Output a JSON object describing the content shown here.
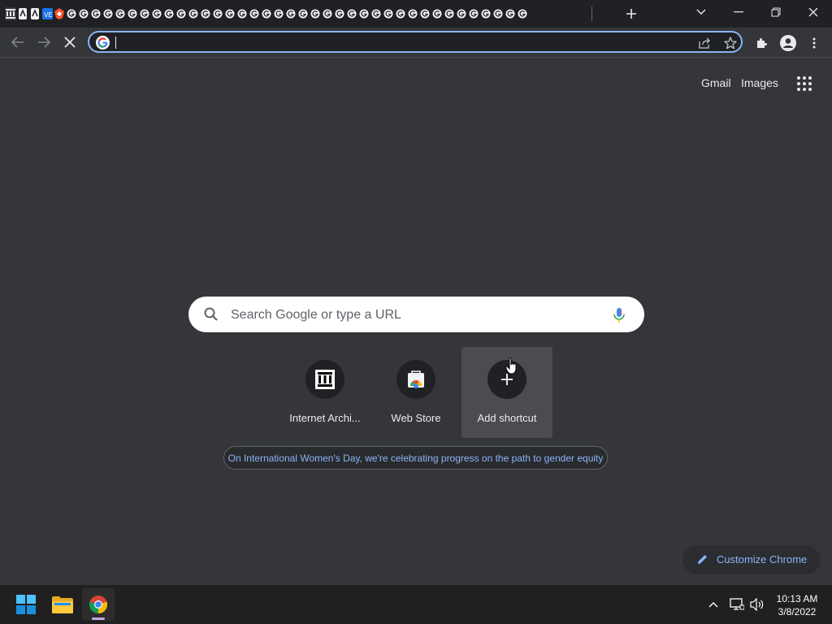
{
  "browser": {
    "omnibox": {
      "value": "",
      "placeholder": ""
    },
    "tab_favicons": [
      "internet-archive",
      "wayback",
      "wayback",
      "vlc",
      "brave",
      "google",
      "google",
      "google",
      "google",
      "google",
      "google",
      "google",
      "google",
      "google",
      "google",
      "google",
      "google",
      "google",
      "google",
      "google",
      "google",
      "google",
      "google",
      "google",
      "google",
      "google",
      "google",
      "google",
      "google",
      "google",
      "google",
      "google",
      "google",
      "google",
      "google",
      "google",
      "google",
      "google",
      "google",
      "google",
      "google",
      "google",
      "google"
    ]
  },
  "header": {
    "gmail_label": "Gmail",
    "images_label": "Images"
  },
  "search": {
    "placeholder": "Search Google or type a URL"
  },
  "shortcuts": [
    {
      "label": "Internet Archi...",
      "icon": "internet-archive-icon"
    },
    {
      "label": "Web Store",
      "icon": "chrome-web-store-icon"
    },
    {
      "label": "Add shortcut",
      "icon": "plus-icon"
    }
  ],
  "promo": {
    "text": "On International Women's Day, we're celebrating progress on the path to gender equity"
  },
  "customize": {
    "label": "Customize Chrome"
  },
  "taskbar": {
    "time": "10:13 AM",
    "date": "3/8/2022"
  },
  "colors": {
    "background": "#35363a",
    "titlebar": "#202124",
    "accent": "#8ab4f8",
    "taskbar": "#202020"
  }
}
